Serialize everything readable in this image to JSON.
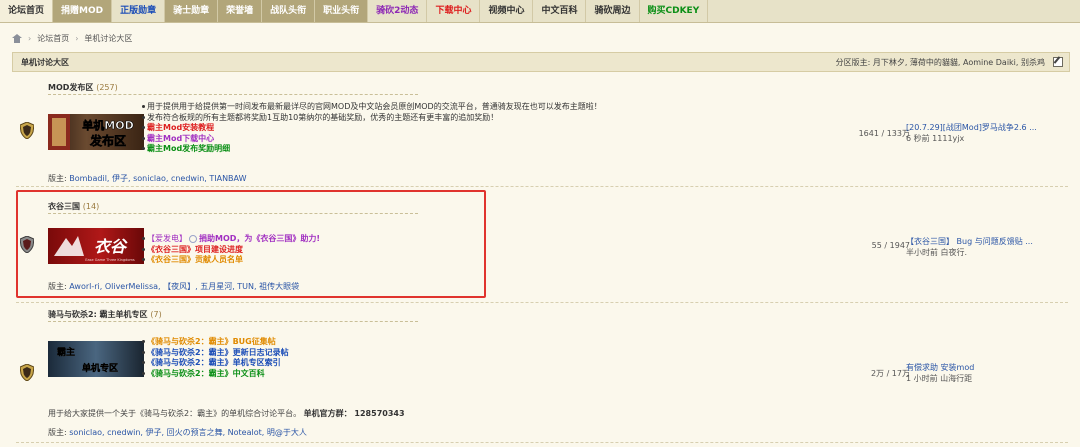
{
  "nav": {
    "tabs": [
      {
        "label": "论坛首页",
        "style": "active"
      },
      {
        "label": "捐赠MOD",
        "style": "dark"
      },
      {
        "label": "正版勋章",
        "style": "blue"
      },
      {
        "label": "骑士勋章",
        "style": "dark"
      },
      {
        "label": "荣誉墙",
        "style": "dark"
      },
      {
        "label": "战队头衔",
        "style": "dark"
      },
      {
        "label": "职业头衔",
        "style": "dark"
      },
      {
        "label": "骑砍2动态",
        "style": "purple"
      },
      {
        "label": "下载中心",
        "style": "red"
      },
      {
        "label": "视频中心",
        "style": "light"
      },
      {
        "label": "中文百科",
        "style": "light"
      },
      {
        "label": "骑砍周边",
        "style": "light"
      },
      {
        "label": "购买CDKEY",
        "style": "green"
      }
    ]
  },
  "breadcrumb": {
    "items": [
      "论坛首页",
      "单机讨论大区"
    ],
    "separator": "›"
  },
  "panel": {
    "title": "单机讨论大区",
    "moderators": "分区版主: 月下林夕, 薄荷中的貓貓, Aomine Daiki, 别杀鸡"
  },
  "forums": [
    {
      "title": "MOD发布区",
      "count": "(257)",
      "banner_text_1": "单机MOD",
      "banner_text_2": "发布区",
      "desc_1": "用于提供用于给提供第一时间发布最新最详尽的官网MOD及中文站会员原创MOD的交流平台，普通骑友现在也可以发布主题啦！",
      "desc_2": "发布符合板规的所有主题都将奖励1互助10第纳尔的基础奖励，优秀的主题还有更丰富的追加奖励！",
      "link_1": "霸主Mod安装教程",
      "link_2": "霸主Mod下载中心",
      "link_3": "霸主Mod发布奖励明细",
      "stats": "1641 / 133万",
      "last_title": "[20.7.29][战团Mod]罗马战争2.6 ...",
      "last_time": "6 秒前 1111yjx",
      "moderators_label": "版主:",
      "moderators": "Bombadil, 伊子, soniclao, cnedwin, TIANBAW"
    },
    {
      "title": "衣谷三国",
      "count": "(14)",
      "banner_text": "衣谷",
      "banner_sub": "Ease Game Three Kingdoms",
      "link_1": "【爱发电】",
      "link_1b": "捐助MOD，为《衣谷三国》助力!",
      "link_2": "《衣谷三国》项目建设进度",
      "link_3": "《衣谷三国》贡献人员名单",
      "stats": "55 / 1947",
      "last_title": "【衣谷三国】 Bug 与问题反馈贴 ...",
      "last_time": "半小时前 白夜行.",
      "moderators_label": "版主:",
      "moderators": "Aworl-ri, OliverMelissa, 【夜风】, 五月星河, TUN, 祖传大眼袋"
    },
    {
      "title": "骑马与砍杀2: 霸主单机专区",
      "count": "(7)",
      "banner_text_1": "霸主",
      "banner_text_2": "单机专区",
      "link_1": "《骑马与砍杀2：霸主》BUG征集帖",
      "link_2": "《骑马与砍杀2：霸主》更新日志记录帖",
      "link_3": "《骑马与砍杀2：霸主》单机专区索引",
      "link_4": "《骑马与砍杀2：霸主》中文百科",
      "stats": "2万 / 17万",
      "last_title": "有偿求助 安装mod",
      "last_time": "1 小时前 山海行距",
      "desc": "用于给大家提供一个关于《骑马与砍杀2：霸主》的单机综合讨论平台。",
      "desc_bold": "单机官方群： 128570343",
      "moderators_label": "版主:",
      "moderators": "soniclao, cnedwin, 伊子, 回火の预言之舞, Notealot, 明@于大人"
    }
  ],
  "colors": {
    "accent_red": "#e0332e",
    "link_red": "#dd1f1f",
    "link_purple": "#a12fc1",
    "link_green": "#0b8f16",
    "link_blue": "#1a4cb7",
    "link_orange": "#e08a00"
  }
}
